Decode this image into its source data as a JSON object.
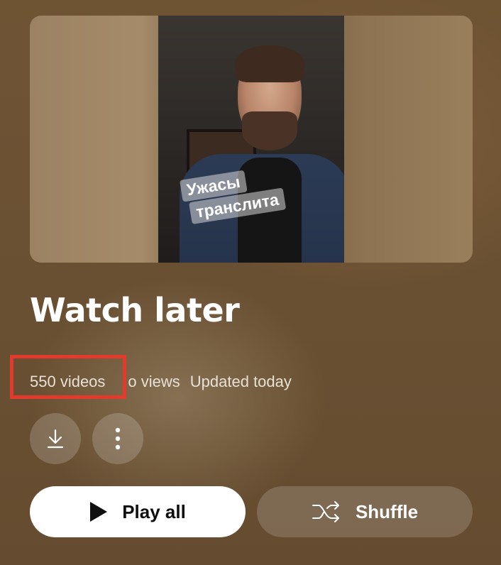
{
  "playlist": {
    "thumbnail_caption_line1": "Ужасы",
    "thumbnail_caption_line2": "транслита",
    "title": "Watch later",
    "video_count": "550 videos",
    "views": "o views",
    "updated": "Updated today"
  },
  "actions": {
    "download_icon": "download-icon",
    "more_icon": "more-vert-icon",
    "play_all_label": "Play all",
    "shuffle_label": "Shuffle"
  },
  "colors": {
    "highlight_box": "#e23a2c",
    "background": "#6e5435"
  }
}
